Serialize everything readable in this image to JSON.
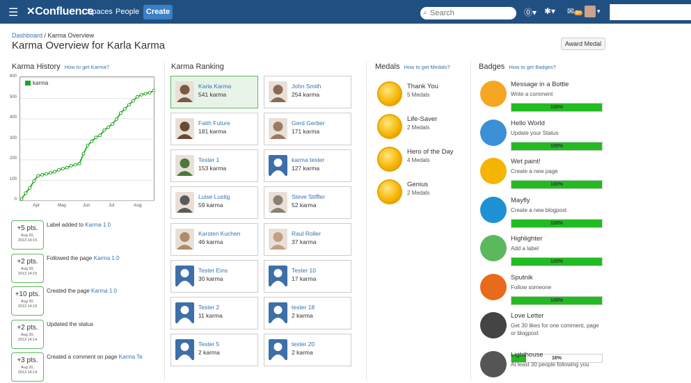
{
  "topbar": {
    "menu_icon": "hamburger-icon",
    "logo": "Confluence",
    "nav": [
      "Spaces",
      "People"
    ],
    "create": "Create",
    "search_placeholder": "Search",
    "icons": [
      "help-icon",
      "gear-icon",
      "notifications-icon",
      "user-avatar"
    ],
    "notification_count": "9+"
  },
  "breadcrumb": {
    "home": "Dashboard",
    "sep": " / ",
    "current": "Karma Overview"
  },
  "page_title": "Karma Overview for Karla Karma",
  "award_button": "Award Medal",
  "history": {
    "title": "Karma History",
    "help": "How to get Karma?",
    "legend": "karma",
    "yticks": [
      "600",
      "500",
      "400",
      "300",
      "200",
      "100",
      "0"
    ],
    "xticks": [
      "Apr",
      "May",
      "Jun",
      "Jul",
      "Aug"
    ],
    "chart_data": {
      "type": "line",
      "title": "",
      "xlabel": "",
      "ylabel": "",
      "ylim": [
        0,
        600
      ],
      "series": [
        {
          "name": "karma",
          "x": [
            "Mar 20",
            "Mar 23",
            "Mar 25",
            "Mar 28",
            "Apr 1",
            "Apr 8",
            "Apr 15",
            "Apr 22",
            "Apr 29",
            "May 6",
            "May 13",
            "May 20",
            "May 27",
            "Jun 1",
            "Jun 3",
            "Jun 5",
            "Jun 7",
            "Jun 9",
            "Jun 12",
            "Jun 16",
            "Jun 23",
            "Jun 30",
            "Jul 7",
            "Jul 10",
            "Jul 14",
            "Jul 18",
            "Jul 22",
            "Jul 27",
            "Aug 2",
            "Aug 6",
            "Aug 12",
            "Aug 16",
            "Aug 20"
          ],
          "values": [
            5,
            35,
            60,
            95,
            120,
            125,
            130,
            135,
            140,
            150,
            155,
            160,
            170,
            175,
            180,
            230,
            270,
            290,
            310,
            320,
            345,
            360,
            375,
            400,
            430,
            450,
            470,
            490,
            510,
            520,
            525,
            530,
            541
          ]
        }
      ]
    },
    "entries": [
      {
        "pts": "+5 pts.",
        "date1": "Aug 20,",
        "date2": "2013 14:15",
        "text": "Label added to ",
        "link": "Karma 1.0"
      },
      {
        "pts": "+2 pts.",
        "date1": "Aug 20,",
        "date2": "2013 14:15",
        "text": "Followed the page ",
        "link": "Karma 1.0"
      },
      {
        "pts": "+10 pts.",
        "date1": "Aug 20,",
        "date2": "2013 14:15",
        "text": "Created the page ",
        "link": "Karma 1.0"
      },
      {
        "pts": "+2 pts.",
        "date1": "Aug 20,",
        "date2": "2013 14:14",
        "text": "Updated the status",
        "link": ""
      },
      {
        "pts": "+3 pts.",
        "date1": "Aug 20,",
        "date2": "2013 14:14",
        "text": "Created a comment on page ",
        "link": "Karma Te"
      }
    ]
  },
  "ranking": {
    "title": "Karma Ranking",
    "users": [
      {
        "name": "Karla Karma",
        "karma": "541 karma"
      },
      {
        "name": "John Smith",
        "karma": "254 karma"
      },
      {
        "name": "Faith Future",
        "karma": "181 karma"
      },
      {
        "name": "Gerd Gerber",
        "karma": "171 karma"
      },
      {
        "name": "Tester 1",
        "karma": "153 karma"
      },
      {
        "name": "karma tester",
        "karma": "127 karma"
      },
      {
        "name": "Luise Lustig",
        "karma": "59 karma"
      },
      {
        "name": "Steve Stiffler",
        "karma": "52 karma"
      },
      {
        "name": "Karsten Kuchen",
        "karma": "46 karma"
      },
      {
        "name": "Raul Roller",
        "karma": "37 karma"
      },
      {
        "name": "Tester Eins",
        "karma": "30 karma"
      },
      {
        "name": "Tester 10",
        "karma": "17 karma"
      },
      {
        "name": "Tester 2",
        "karma": "11 karma"
      },
      {
        "name": "tester 18",
        "karma": "2 karma"
      },
      {
        "name": "Tester 5",
        "karma": "2 karma"
      },
      {
        "name": "tester 20",
        "karma": "2 karma"
      }
    ]
  },
  "medals": {
    "title": "Medals",
    "help": "How to get Medals?",
    "items": [
      {
        "name": "Thank You",
        "count": "5 Medals"
      },
      {
        "name": "Life-Saver",
        "count": "2 Medals"
      },
      {
        "name": "Hero of the Day",
        "count": "4 Medals"
      },
      {
        "name": "Genius",
        "count": "2 Medals"
      }
    ]
  },
  "badges": {
    "title": "Badges",
    "help": "How to get Badges?",
    "items": [
      {
        "name": "Message in a Bottle",
        "desc": "Write a comment",
        "progress": 1.0,
        "label": "100%",
        "color": "#f5a623",
        "icon": "bottle-icon"
      },
      {
        "name": "Hello World",
        "desc": "Update your Status",
        "progress": 1.0,
        "label": "100%",
        "color": "#3b8fd6",
        "icon": "globe-icon"
      },
      {
        "name": "Wet paint!",
        "desc": "Create a new page",
        "progress": 1.0,
        "label": "100%",
        "color": "#f5b400",
        "icon": "paint-brush-icon"
      },
      {
        "name": "Mayfly",
        "desc": "Create a new blogpost",
        "progress": 1.0,
        "label": "100%",
        "color": "#1e90d6",
        "icon": "mayfly-icon"
      },
      {
        "name": "Highlighter",
        "desc": "Add a label",
        "progress": 1.0,
        "label": "100%",
        "color": "#5cb85c",
        "icon": "highlighter-icon"
      },
      {
        "name": "Sputnik",
        "desc": "Follow someone",
        "progress": 1.0,
        "label": "100%",
        "color": "#e86a1a",
        "icon": "sputnik-icon"
      },
      {
        "name": "Love Letter",
        "desc": "Get 30 likes for one comment, page or blogpost",
        "progress": 0.16,
        "label": "16%",
        "color": "#444444",
        "icon": "love-letter-icon"
      },
      {
        "name": "Lighthouse",
        "desc": "At least 30 people following you",
        "progress": 0,
        "label": "",
        "color": "#555555",
        "icon": "lighthouse-icon"
      }
    ]
  }
}
